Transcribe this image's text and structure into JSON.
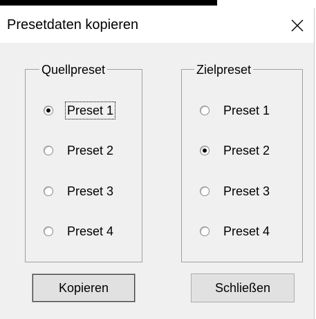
{
  "window": {
    "title": "Presetdaten kopieren"
  },
  "source_group": {
    "legend": "Quellpreset",
    "options": [
      {
        "label": "Preset 1",
        "checked": true
      },
      {
        "label": "Preset 2",
        "checked": false
      },
      {
        "label": "Preset 3",
        "checked": false
      },
      {
        "label": "Preset 4",
        "checked": false
      }
    ]
  },
  "target_group": {
    "legend": "Zielpreset",
    "options": [
      {
        "label": "Preset 1",
        "checked": false
      },
      {
        "label": "Preset 2",
        "checked": true
      },
      {
        "label": "Preset 3",
        "checked": false
      },
      {
        "label": "Preset 4",
        "checked": false
      }
    ]
  },
  "buttons": {
    "copy": "Kopieren",
    "close": "Schließen"
  },
  "icons": {
    "close": "close-icon"
  },
  "colors": {
    "dialog_bg": "#f0f0f0",
    "titlebar_bg": "#ffffff",
    "button_bg": "#e1e1e1"
  }
}
